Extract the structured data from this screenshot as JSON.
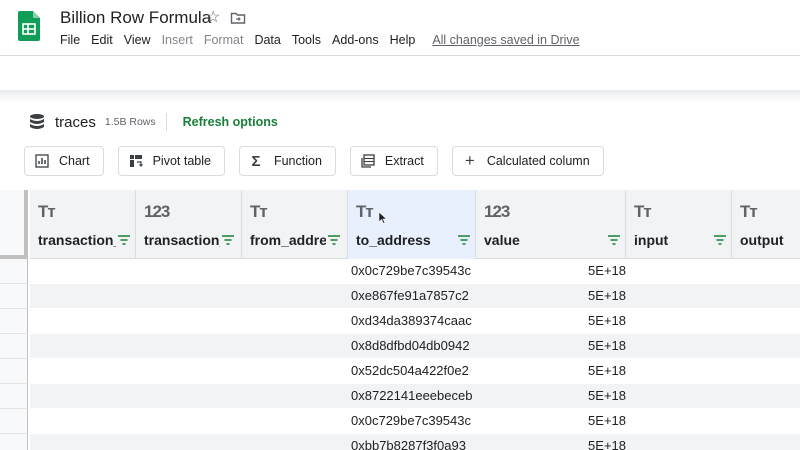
{
  "window": {
    "title": "Billion Row Formula",
    "star_icon": "star-icon",
    "folder_icon": "move-to-folder-icon"
  },
  "menu": {
    "items": [
      {
        "label": "File",
        "enabled": true
      },
      {
        "label": "Edit",
        "enabled": true
      },
      {
        "label": "View",
        "enabled": true
      },
      {
        "label": "Insert",
        "enabled": false
      },
      {
        "label": "Format",
        "enabled": false
      },
      {
        "label": "Data",
        "enabled": true
      },
      {
        "label": "Tools",
        "enabled": true
      },
      {
        "label": "Add-ons",
        "enabled": true
      },
      {
        "label": "Help",
        "enabled": true
      }
    ],
    "save_status": "All changes saved in Drive"
  },
  "connected_sheet": {
    "source_name": "traces",
    "row_count": "1.5B Rows",
    "refresh_label": "Refresh options",
    "accent_color": "#188038"
  },
  "actions": [
    {
      "label": "Chart",
      "icon": "chart-icon"
    },
    {
      "label": "Pivot table",
      "icon": "pivot-table-icon"
    },
    {
      "label": "Function",
      "icon": "sigma-icon"
    },
    {
      "label": "Extract",
      "icon": "extract-icon"
    },
    {
      "label": "Calculated column",
      "icon": "plus-icon"
    }
  ],
  "columns": [
    {
      "type": "Tт",
      "name": "transaction_hash"
    },
    {
      "type": "123",
      "name": "transaction_index"
    },
    {
      "type": "Tт",
      "name": "from_address"
    },
    {
      "type": "Tт",
      "name": "to_address"
    },
    {
      "type": "123",
      "name": "value"
    },
    {
      "type": "Tт",
      "name": "input"
    },
    {
      "type": "Tт",
      "name": "output"
    }
  ],
  "rows": [
    {
      "to_address": "0x0c729be7c39543c",
      "value": "5E+18"
    },
    {
      "to_address": "0xe867fe91a7857c2",
      "value": "5E+18"
    },
    {
      "to_address": "0xd34da389374caac",
      "value": "5E+18"
    },
    {
      "to_address": "0x8d8dfbd04db0942",
      "value": "5E+18"
    },
    {
      "to_address": "0x52dc504a422f0e2",
      "value": "5E+18"
    },
    {
      "to_address": "0x8722141eeebeceb",
      "value": "5E+18"
    },
    {
      "to_address": "0x0c729be7c39543c",
      "value": "5E+18"
    },
    {
      "to_address": "0xbb7b8287f3f0a93",
      "value": "5E+18"
    }
  ]
}
